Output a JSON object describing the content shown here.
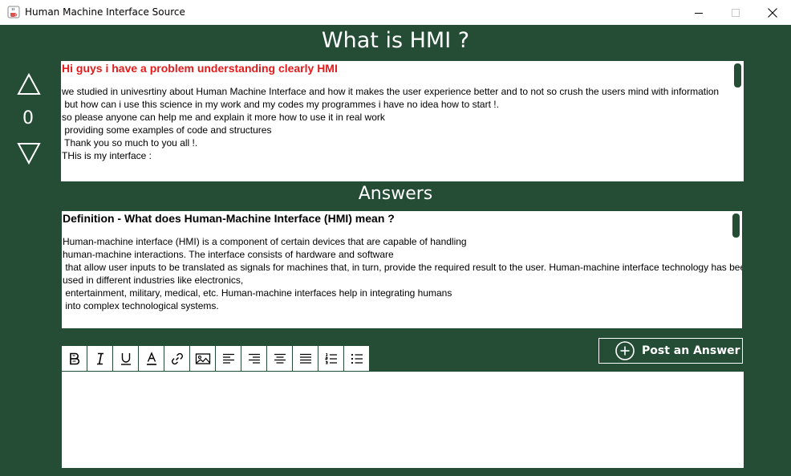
{
  "window": {
    "title": "Human Machine Interface Source",
    "app_icon": "java-cup-icon",
    "controls": [
      "minimize-icon",
      "maximize-icon",
      "close-icon"
    ]
  },
  "question": {
    "title": "What is HMI ?",
    "votes": "0",
    "heading": "Hi guys i have a problem understanding clearly HMI",
    "body_lines": [
      "we studied in univesrtiny about Human Machine Interface and how it makes the user experience better and to not so crush the users mind with information",
      " but how can i use this science in my work and my codes my programmes i have no idea how to start !.",
      "so please anyone can help me and explain it more how to use it in real work",
      " providing some examples of code and structures",
      " Thank you so much to you all !.",
      "THis is my interface :"
    ]
  },
  "answers": {
    "heading": "Answers",
    "items": [
      {
        "heading": "Definition - What does Human-Machine Interface (HMI) mean ?",
        "body_lines": [
          "Human-machine interface (HMI) is a component of certain devices that are capable of handling",
          "human-machine interactions. The interface consists of hardware and software",
          " that allow user inputs to be translated as signals for machines that, in turn, provide the required result to the user. Human-machine interface technology has been",
          "used in different industries like electronics,",
          " entertainment, military, medical, etc. Human-machine interfaces help in integrating humans",
          " into complex technological systems."
        ]
      }
    ]
  },
  "editor": {
    "toolbar": [
      {
        "name": "bold-icon"
      },
      {
        "name": "italic-icon"
      },
      {
        "name": "underline-icon"
      },
      {
        "name": "text-color-icon"
      },
      {
        "name": "link-icon"
      },
      {
        "name": "image-icon"
      },
      {
        "name": "align-left-icon"
      },
      {
        "name": "align-right-icon"
      },
      {
        "name": "align-center-icon"
      },
      {
        "name": "align-justify-icon"
      },
      {
        "name": "numbered-list-icon"
      },
      {
        "name": "bullet-list-icon"
      }
    ],
    "post_label": "Post an Answer",
    "value": ""
  },
  "colors": {
    "background": "#254d36",
    "question_heading": "#e31b1b",
    "text_on_dark": "#ffffff"
  }
}
